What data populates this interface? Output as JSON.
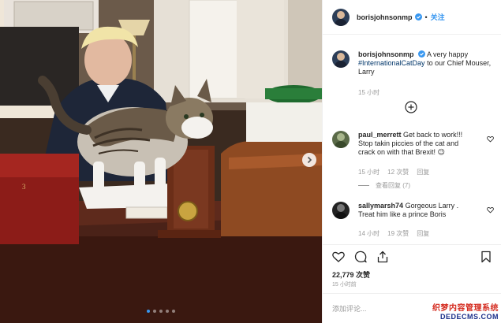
{
  "header": {
    "username": "borisjohnsonmp",
    "separator": "•",
    "follow_label": "关注"
  },
  "caption": {
    "username": "borisjohnsonmp",
    "text_before": "A very happy ",
    "hashtag": "#InternationalCatDay",
    "text_after": " to our Chief Mouser, Larry",
    "time": "15 小时"
  },
  "comments": [
    {
      "username": "paul_merrett",
      "text": "Get back to work!!! Stop takin piccies of the cat and crack on with that Brexit! 😉",
      "time": "15 小时",
      "likes": "12 次赞",
      "reply": "回复",
      "view_replies": "查看回复 (7)"
    },
    {
      "username": "sallymarsh74",
      "text": "Gorgeous Larry . Treat him like a prince Boris",
      "time": "14 小时",
      "likes": "19 次赞",
      "reply": "回复"
    }
  ],
  "stats": {
    "likes": "22,779 次赞",
    "timestamp": "15 小时前"
  },
  "add_comment": {
    "placeholder": "添加评论..."
  },
  "watermark": {
    "line1": "织梦内容管理系统",
    "line2": "DEDECMS.COM"
  },
  "carousel": {
    "total": 5,
    "active": 1
  },
  "colors": {
    "link_blue": "#3897f0",
    "hashtag": "#003569",
    "muted": "#999999"
  }
}
